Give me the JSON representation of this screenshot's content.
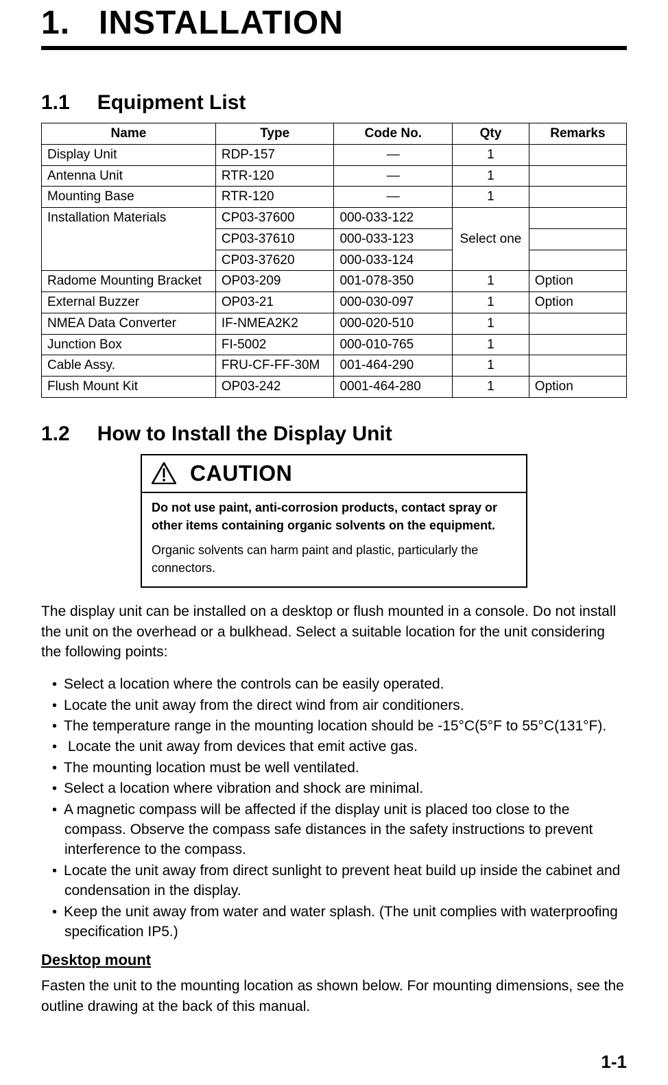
{
  "chapter_number": "1.",
  "chapter_title": "INSTALLATION",
  "section1": {
    "num": "1.1",
    "title": "Equipment List"
  },
  "table": {
    "headers": {
      "name": "Name",
      "type": "Type",
      "code": "Code No.",
      "qty": "Qty",
      "remarks": "Remarks"
    },
    "display_unit": {
      "name": "Display Unit",
      "type": "RDP-157",
      "code": "—",
      "qty": "1",
      "remarks": ""
    },
    "antenna_unit": {
      "name": "Antenna Unit",
      "type": "RTR-120",
      "code": "—",
      "qty": "1",
      "remarks": ""
    },
    "mounting_base": {
      "name": "Mounting Base",
      "type": "RTR-120",
      "code": "—",
      "qty": "1",
      "remarks": ""
    },
    "install_mat_a": {
      "name": "Installation Materials",
      "type": "CP03-37600",
      "code": "000-033-122"
    },
    "install_mat_b": {
      "type": "CP03-37610",
      "code": "000-033-123"
    },
    "install_mat_c": {
      "type": "CP03-37620",
      "code": "000-033-124"
    },
    "install_mat_qty": "Select one",
    "radome": {
      "name": "Radome Mounting Bracket",
      "type": "OP03-209",
      "code": "001-078-350",
      "qty": "1",
      "remarks": "Option"
    },
    "buzzer": {
      "name": "External Buzzer",
      "type": "OP03-21",
      "code": "000-030-097",
      "qty": "1",
      "remarks": "Option"
    },
    "nmea": {
      "name": "NMEA Data Converter",
      "type": "IF-NMEA2K2",
      "code": "000-020-510",
      "qty": "1",
      "remarks": ""
    },
    "junction": {
      "name": "Junction Box",
      "type": "FI-5002",
      "code": "000-010-765",
      "qty": "1",
      "remarks": ""
    },
    "cable": {
      "name": "Cable Assy.",
      "type": "FRU-CF-FF-30M",
      "code": "001-464-290",
      "qty": "1",
      "remarks": ""
    },
    "flush": {
      "name": "Flush Mount Kit",
      "type": "OP03-242",
      "code": "0001-464-280",
      "qty": "1",
      "remarks": "Option"
    }
  },
  "section2": {
    "num": "1.2",
    "title": "How to Install the Display Unit"
  },
  "caution": {
    "title": "CAUTION",
    "bold": "Do not use paint, anti-corrosion products, contact spray or other items containing organic solvents on the equipment.",
    "text": "Organic solvents can harm paint and plastic, particularly the connectors."
  },
  "intro_para": "The display unit can be installed on a desktop or flush mounted in a console. Do not install the unit on the overhead or a bulkhead. Select a suitable location for the unit considering the following points:",
  "bullets": [
    "Select a location where the controls can be easily operated.",
    "Locate the unit away from the direct wind from air conditioners.",
    "The temperature range in the mounting location should be -15°C(5°F to 55°C(131°F).",
    " Locate the unit away from devices that emit active gas.",
    "The mounting location must be well ventilated.",
    "Select a location where vibration and shock are minimal.",
    "A magnetic compass will be affected if the display unit is placed too close to the compass. Observe the compass safe distances in the safety instructions to prevent interference to the compass.",
    "Locate the unit away from direct sunlight to prevent heat build up inside the cabinet and condensation in the display.",
    "Keep the unit away from water and water splash. (The unit complies with waterproofing specification IP5.)"
  ],
  "desktop_heading": "Desktop mount",
  "desktop_para": "Fasten the unit to the mounting location as shown below. For mounting dimensions, see the outline drawing at the back of this manual.",
  "page_number": "1-1"
}
